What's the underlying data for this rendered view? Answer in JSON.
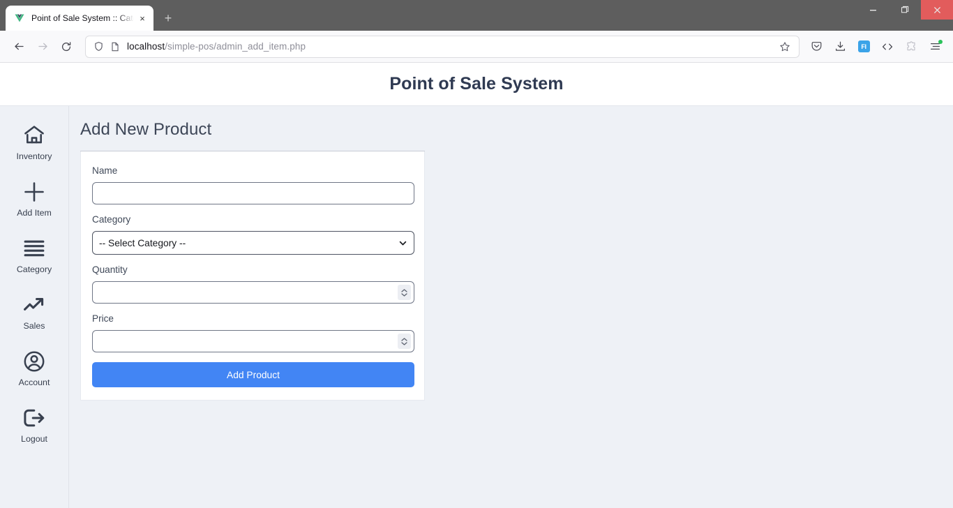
{
  "browser": {
    "tab": {
      "title": "Point of Sale System :: Categorie",
      "favicon": "vue-logo-icon",
      "close": "×"
    },
    "new_tab": "+",
    "window_controls": {
      "minimize": "minimize-icon",
      "maximize": "maximize-icon",
      "close": "close-icon"
    },
    "nav": {
      "back": "back-arrow-icon",
      "forward": "forward-arrow-icon",
      "reload": "reload-icon"
    },
    "url": {
      "host": "localhost",
      "path": "/simple-pos/admin_add_item.php",
      "shield_icon": "shield-icon",
      "page_icon": "page-doc-icon",
      "bookmark_icon": "star-icon"
    },
    "toolbar": {
      "pocket": "pocket-icon",
      "downloads": "download-icon",
      "extension_fi": "FI",
      "devtools": "code-brackets-icon",
      "extensions": "puzzle-icon",
      "app_menu": "hamburger-menu-icon"
    }
  },
  "header": {
    "title": "Point of Sale System"
  },
  "sidebar": {
    "items": [
      {
        "label": "Inventory",
        "icon": "home-icon"
      },
      {
        "label": "Add Item",
        "icon": "plus-icon"
      },
      {
        "label": "Category",
        "icon": "list-lines-icon"
      },
      {
        "label": "Sales",
        "icon": "trending-up-icon"
      },
      {
        "label": "Account",
        "icon": "user-circle-icon"
      },
      {
        "label": "Logout",
        "icon": "logout-icon"
      }
    ]
  },
  "main": {
    "page_title": "Add New Product",
    "form": {
      "name": {
        "label": "Name",
        "value": "",
        "placeholder": ""
      },
      "category": {
        "label": "Category",
        "selected": "-- Select Category --",
        "options": [
          "-- Select Category --"
        ]
      },
      "quantity": {
        "label": "Quantity",
        "value": "",
        "placeholder": ""
      },
      "price": {
        "label": "Price",
        "value": "",
        "placeholder": ""
      },
      "submit_label": "Add Product"
    }
  },
  "colors": {
    "accent": "#4285f4",
    "page_bg": "#eef1f6",
    "header_text": "#2f3a52",
    "close_btn": "#e25c5c",
    "notification_dot": "#2ac25a"
  }
}
